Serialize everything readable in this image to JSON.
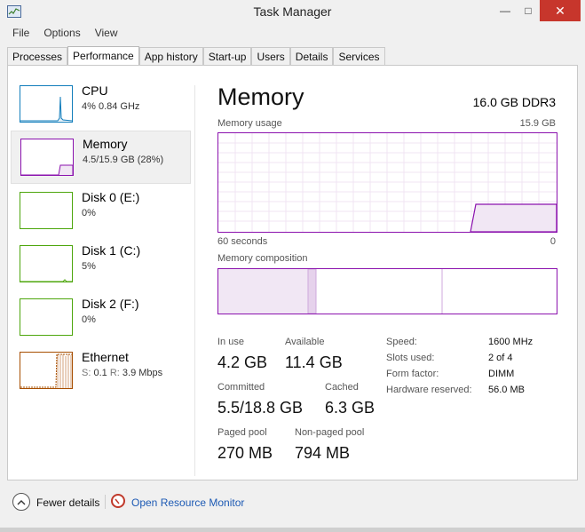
{
  "window": {
    "title": "Task Manager",
    "minimize_glyph": "—",
    "maximize_glyph": "□",
    "close_glyph": "✕"
  },
  "menu": [
    "File",
    "Options",
    "View"
  ],
  "tabs": [
    {
      "label": "Processes",
      "active": false
    },
    {
      "label": "Performance",
      "active": true
    },
    {
      "label": "App history",
      "active": false
    },
    {
      "label": "Start-up",
      "active": false
    },
    {
      "label": "Users",
      "active": false
    },
    {
      "label": "Details",
      "active": false
    },
    {
      "label": "Services",
      "active": false
    }
  ],
  "sidebar": {
    "cpu": {
      "name": "CPU",
      "sub": "4%  0.84 GHz",
      "color": "#117dbb"
    },
    "memory": {
      "name": "Memory",
      "sub": "4.5/15.9 GB (28%)",
      "color": "#8b12ae"
    },
    "disk0": {
      "name": "Disk 0 (E:)",
      "sub": "0%",
      "color": "#4da60c"
    },
    "disk1": {
      "name": "Disk 1 (C:)",
      "sub": "5%",
      "color": "#4da60c"
    },
    "disk2": {
      "name": "Disk 2 (F:)",
      "sub": "0%",
      "color": "#4da60c"
    },
    "ethernet": {
      "name": "Ethernet",
      "send_label": "S:",
      "send_value": "0.1",
      "recv_label": "R:",
      "recv_value": "3.9 Mbps",
      "color": "#a74f01"
    }
  },
  "main": {
    "title": "Memory",
    "spec": "16.0 GB DDR3",
    "usage_label": "Memory usage",
    "usage_max": "15.9 GB",
    "time_left": "60 seconds",
    "time_right": "0",
    "composition_label": "Memory composition",
    "accent": "#8b12ae",
    "usage_level": 0.28
  },
  "stats": {
    "in_use_label": "In use",
    "in_use": "4.2 GB",
    "available_label": "Available",
    "available": "11.4 GB",
    "committed_label": "Committed",
    "committed": "5.5/18.8 GB",
    "cached_label": "Cached",
    "cached": "6.3 GB",
    "paged_label": "Paged pool",
    "paged": "270 MB",
    "nonpaged_label": "Non-paged pool",
    "nonpaged": "794 MB"
  },
  "specs": {
    "speed_label": "Speed:",
    "speed": "1600 MHz",
    "slots_label": "Slots used:",
    "slots": "2 of 4",
    "form_label": "Form factor:",
    "form": "DIMM",
    "reserved_label": "Hardware reserved:",
    "reserved": "56.0 MB"
  },
  "footer": {
    "fewer": "Fewer details",
    "resource_monitor": "Open Resource Monitor"
  }
}
